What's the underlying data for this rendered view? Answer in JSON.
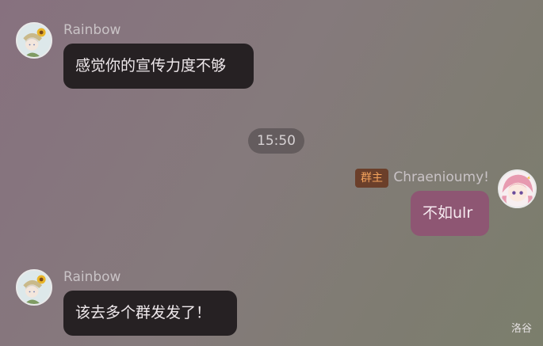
{
  "messages": [
    {
      "sender": "Rainbow",
      "text": "感觉你的宣传力度不够",
      "avatar_icon": "sunflower-girl-avatar-icon"
    },
    {
      "sender": "Chraenioumy!",
      "role_badge": "群主",
      "text": "不如ulr",
      "avatar_icon": "pink-hair-girl-avatar-icon"
    },
    {
      "sender": "Rainbow",
      "text": "该去多个群发发了！",
      "avatar_icon": "sunflower-girl-avatar-icon"
    }
  ],
  "time_separator": "15:50",
  "watermark": "洛谷",
  "colors": {
    "incoming_bubble": "#262123",
    "outgoing_bubble": "#8e5673",
    "role_badge_bg": "#6b3f2a",
    "role_badge_text": "#f2a25c",
    "sender_name": "#c9c3c6"
  }
}
